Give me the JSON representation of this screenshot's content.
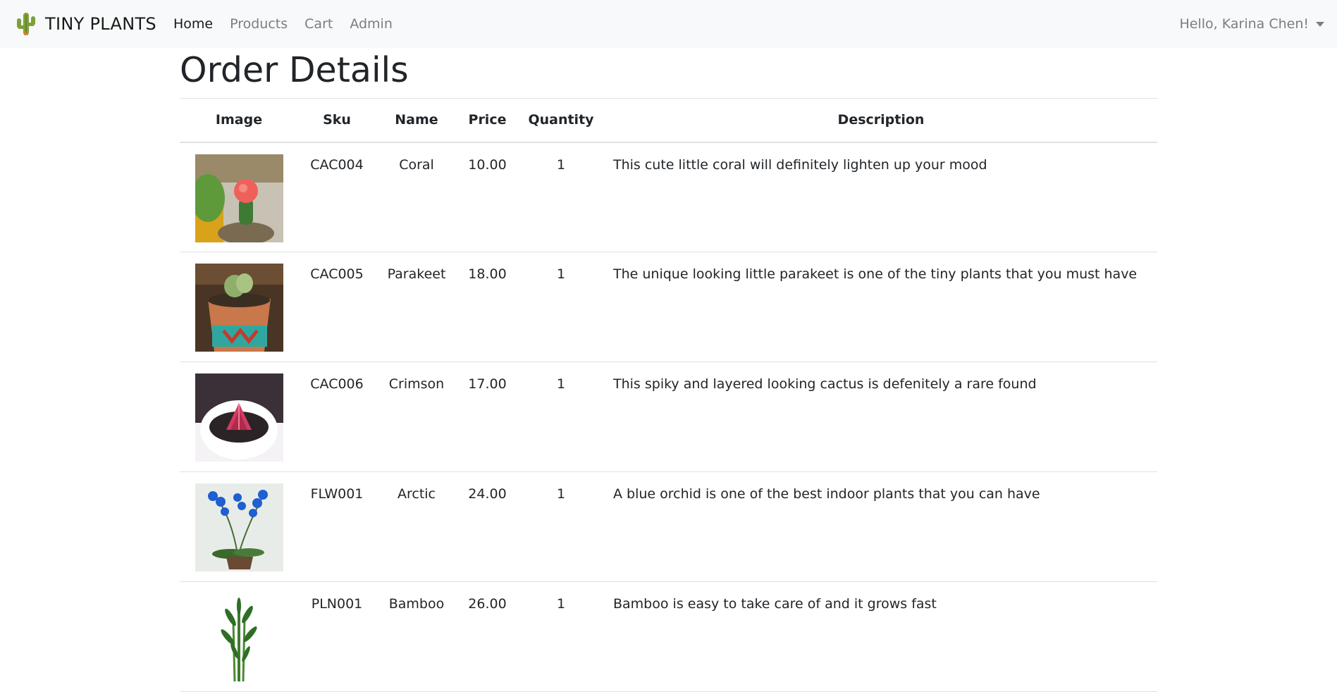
{
  "nav": {
    "brand": "TINY PLANTS",
    "links": [
      {
        "label": "Home",
        "active": true
      },
      {
        "label": "Products",
        "active": false
      },
      {
        "label": "Cart",
        "active": false
      },
      {
        "label": "Admin",
        "active": false
      }
    ],
    "user_greeting": "Hello, Karina Chen!"
  },
  "page": {
    "title": "Order Details"
  },
  "table": {
    "columns": [
      "Image",
      "Sku",
      "Name",
      "Price",
      "Quantity",
      "Description"
    ],
    "rows": [
      {
        "sku": "CAC004",
        "name": "Coral",
        "price": "10.00",
        "quantity": "1",
        "description": "This cute little coral will definitely lighten up your mood"
      },
      {
        "sku": "CAC005",
        "name": "Parakeet",
        "price": "18.00",
        "quantity": "1",
        "description": "The unique looking little parakeet is one of the tiny plants that you must have"
      },
      {
        "sku": "CAC006",
        "name": "Crimson",
        "price": "17.00",
        "quantity": "1",
        "description": "This spiky and layered looking cactus is defenitely a rare found"
      },
      {
        "sku": "FLW001",
        "name": "Arctic",
        "price": "24.00",
        "quantity": "1",
        "description": "A blue orchid is one of the best indoor plants that you can have"
      },
      {
        "sku": "PLN001",
        "name": "Bamboo",
        "price": "26.00",
        "quantity": "1",
        "description": "Bamboo is easy to take care of and it grows fast"
      }
    ]
  }
}
